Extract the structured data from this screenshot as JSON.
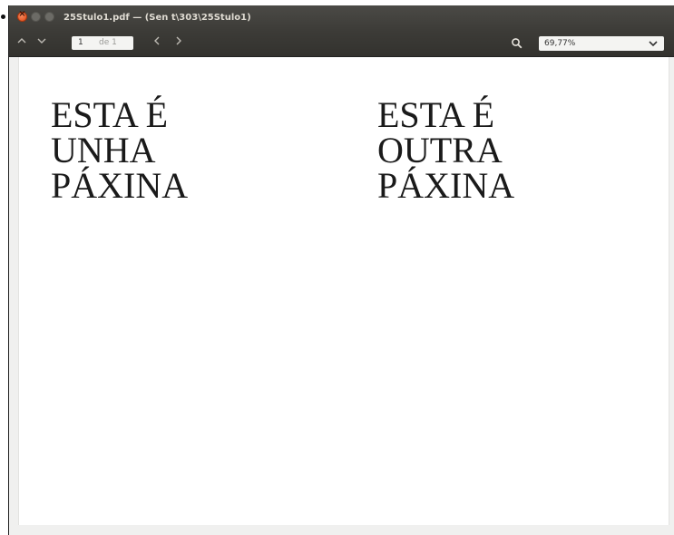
{
  "window": {
    "title": "25Stulo1.pdf — (Sen t\\303\\25Stulo1)"
  },
  "toolbar": {
    "page_current": "1",
    "page_of": "de 1",
    "zoom_value": "69,77%"
  },
  "document": {
    "left_column": [
      "ESTA É",
      "UNHA",
      "PÁXINA"
    ],
    "right_column": [
      "ESTA É",
      "OUTRA",
      "PÁXINA"
    ]
  },
  "icons": {
    "close": "close-icon",
    "previous_page": "chevron-up-icon",
    "next_page": "chevron-down-icon",
    "back": "chevron-left-icon",
    "forward": "chevron-right-icon",
    "search": "search-icon",
    "dropdown": "chevron-down-icon"
  },
  "colors": {
    "titlebar": "#3c3b37",
    "close_button": "#df4a16",
    "page_background": "#ffffff"
  }
}
